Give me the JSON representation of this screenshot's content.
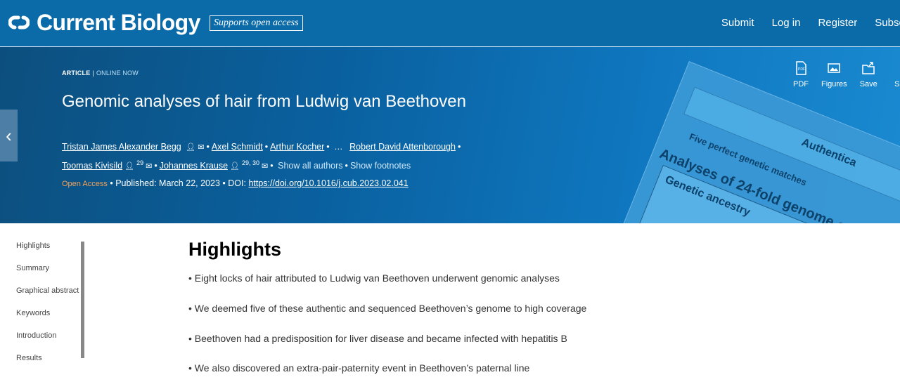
{
  "header": {
    "brand": "Current Biology",
    "badge": "Supports open access",
    "nav": [
      "Submit",
      "Log in",
      "Register",
      "Subsc"
    ]
  },
  "article": {
    "type": "ARTICLE",
    "separator": "|",
    "status": "ONLINE NOW",
    "title": "Genomic analyses of hair from Ludwig van Beethoven",
    "authors": [
      {
        "name": "Tristan James Alexander Begg"
      },
      {
        "name": "Axel Schmidt"
      },
      {
        "name": "Arthur Kocher"
      },
      {
        "name": "…"
      },
      {
        "name": "Robert David Attenborough"
      },
      {
        "name": "Toomas Kivisild",
        "sup": "29"
      },
      {
        "name": "Johannes Krause",
        "sup": "29, 30"
      }
    ],
    "show_all_authors": "Show all authors",
    "show_footnotes": "Show footnotes",
    "open_access": "Open Access",
    "published": "Published: March 22, 2023",
    "doi_label": "DOI:",
    "doi": "https://doi.org/10.1016/j.cub.2023.02.041"
  },
  "tools": [
    "PDF",
    "Figures",
    "Save",
    "S"
  ],
  "cover": {
    "lines": [
      "Authentica",
      "Five perfect genetic matches",
      "Analyses of 24-fold genome of L",
      "Genetic ancestry"
    ]
  },
  "sidebar": {
    "items": [
      "Highlights",
      "Summary",
      "Graphical abstract",
      "Keywords",
      "Introduction",
      "Results"
    ]
  },
  "highlights": {
    "heading": "Highlights",
    "items": [
      "• Eight locks of hair attributed to Ludwig van Beethoven underwent genomic analyses",
      "• We deemed five of these authentic and sequenced Beethoven’s genome to high coverage",
      "• Beethoven had a predisposition for liver disease and became infected with hepatitis B",
      "• We also discovered an extra-pair-paternity event in Beethoven’s paternal line"
    ]
  }
}
